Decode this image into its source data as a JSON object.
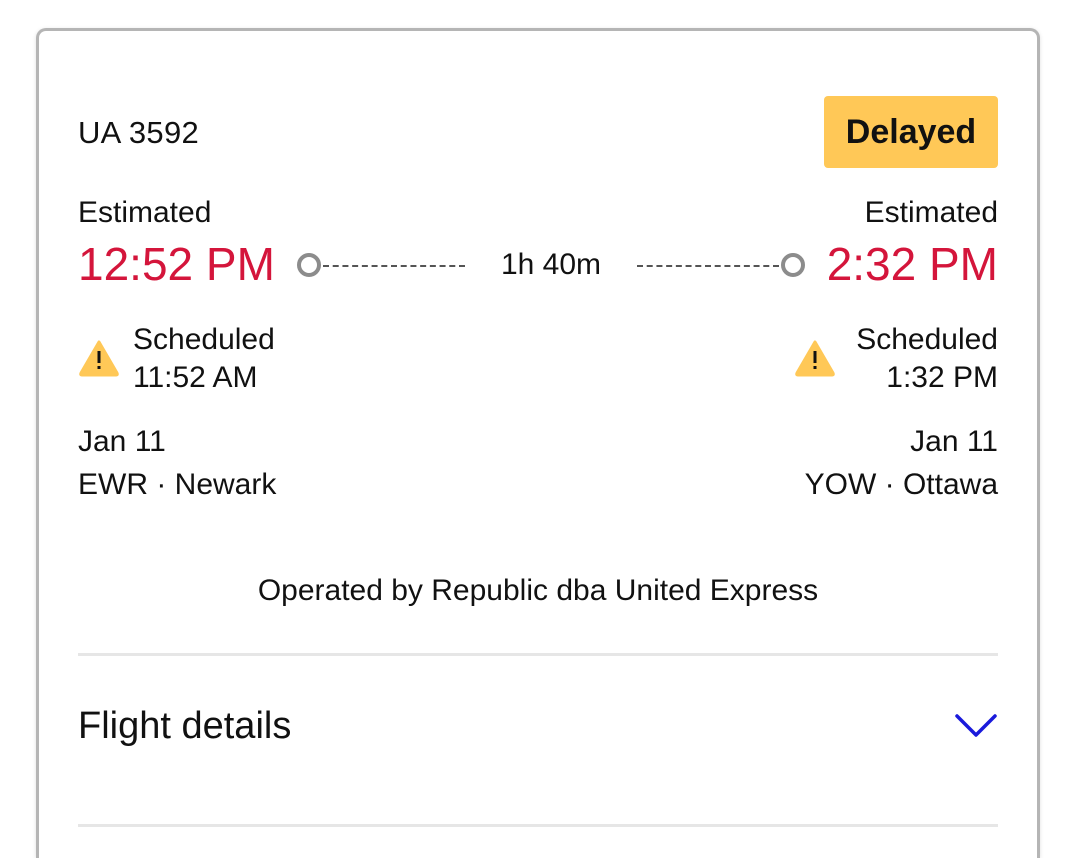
{
  "flight": {
    "number": "UA 3592",
    "status": "Delayed",
    "duration": "1h 40m",
    "operator": "Operated by Republic dba United Express"
  },
  "departure": {
    "estimated_label": "Estimated",
    "estimated_time": "12:52 PM",
    "scheduled_label": "Scheduled",
    "scheduled_time": "11:52 AM",
    "date": "Jan 11",
    "airport": "EWR · Newark"
  },
  "arrival": {
    "estimated_label": "Estimated",
    "estimated_time": "2:32 PM",
    "scheduled_label": "Scheduled",
    "scheduled_time": "1:32 PM",
    "date": "Jan 11",
    "airport": "YOW · Ottawa"
  },
  "details": {
    "label": "Flight details",
    "icon": "chevron-down-icon"
  },
  "colors": {
    "delay_red": "#d4153b",
    "badge_yellow": "#ffc857",
    "chevron_blue": "#1a1adb",
    "warning_yellow": "#ffc857"
  }
}
